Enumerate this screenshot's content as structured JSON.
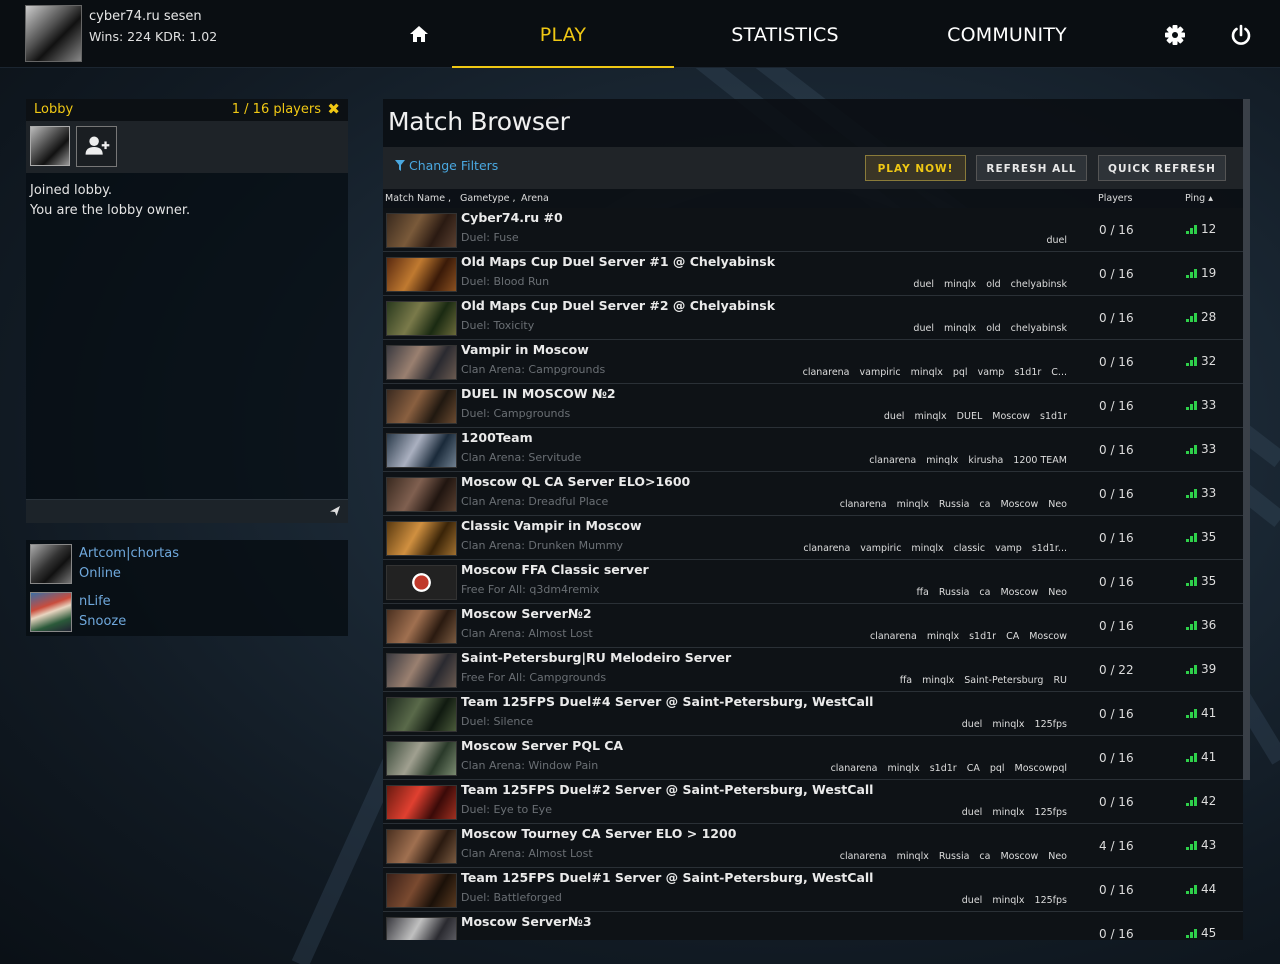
{
  "user": {
    "name": "cyber74.ru sesen",
    "stats": "Wins: 224 KDR: 1.02"
  },
  "nav": {
    "play": "PLAY",
    "statistics": "STATISTICS",
    "community": "COMMUNITY"
  },
  "lobby": {
    "title": "Lobby",
    "count": "1 / 16 players",
    "close": "✖",
    "messages": [
      "Joined lobby.",
      "You are the lobby owner."
    ]
  },
  "friends": [
    {
      "name": "Artcom|chortas",
      "status": "Online"
    },
    {
      "name": "nLife",
      "status": "Snooze"
    }
  ],
  "browser": {
    "title": "Match Browser",
    "filters": "Change Filters",
    "buttons": {
      "play_now": "PLAY NOW!",
      "refresh_all": "REFRESH ALL",
      "quick_refresh": "QUICK REFRESH"
    },
    "columns": {
      "name": "Match Name ,",
      "gametype": "Gametype ,",
      "arena": "Arena",
      "players": "Players",
      "ping": "Ping ▴"
    },
    "matches": [
      {
        "name": "Cyber74.ru #0",
        "sub": "Duel: Fuse",
        "tags": [
          "duel"
        ],
        "players": "0 / 16",
        "ping": "12"
      },
      {
        "name": "Old Maps Cup Duel Server #1 @ Chelyabinsk",
        "sub": "Duel: Blood Run",
        "tags": [
          "duel",
          "minqlx",
          "old",
          "chelyabinsk"
        ],
        "players": "0 / 16",
        "ping": "19"
      },
      {
        "name": "Old Maps Cup Duel Server #2 @ Chelyabinsk",
        "sub": "Duel: Toxicity",
        "tags": [
          "duel",
          "minqlx",
          "old",
          "chelyabinsk"
        ],
        "players": "0 / 16",
        "ping": "28"
      },
      {
        "name": "Vampir in Moscow",
        "sub": "Clan Arena: Campgrounds",
        "tags": [
          "clanarena",
          "vampiric",
          "minqlx",
          "pql",
          "vamp",
          "s1d1r",
          "C..."
        ],
        "players": "0 / 16",
        "ping": "32"
      },
      {
        "name": "DUEL IN MOSCOW №2",
        "sub": "Duel: Campgrounds",
        "tags": [
          "duel",
          "minqlx",
          "DUEL",
          "Moscow",
          "s1d1r"
        ],
        "players": "0 / 16",
        "ping": "33"
      },
      {
        "name": "1200Team",
        "sub": "Clan Arena: Servitude",
        "tags": [
          "clanarena",
          "minqlx",
          "kirusha",
          "1200 TEAM"
        ],
        "players": "0 / 16",
        "ping": "33"
      },
      {
        "name": "Moscow QL CA Server ELO>1600",
        "sub": "Clan Arena: Dreadful Place",
        "tags": [
          "clanarena",
          "minqlx",
          "Russia",
          "ca",
          "Moscow",
          "Neo"
        ],
        "players": "0 / 16",
        "ping": "33"
      },
      {
        "name": "Classic Vampir in Moscow",
        "sub": "Clan Arena: Drunken Mummy",
        "tags": [
          "clanarena",
          "vampiric",
          "minqlx",
          "classic",
          "vamp",
          "s1d1r..."
        ],
        "players": "0 / 16",
        "ping": "35"
      },
      {
        "name": "Moscow FFA Classic server",
        "sub": "Free For All: q3dm4remix",
        "tags": [
          "ffa",
          "Russia",
          "ca",
          "Moscow",
          "Neo"
        ],
        "players": "0 / 16",
        "ping": "35"
      },
      {
        "name": "Moscow Server№2",
        "sub": "Clan Arena: Almost Lost",
        "tags": [
          "clanarena",
          "minqlx",
          "s1d1r",
          "CA",
          "Moscow"
        ],
        "players": "0 / 16",
        "ping": "36"
      },
      {
        "name": "Saint-Petersburg|RU Melodeiro Server",
        "sub": "Free For All: Campgrounds",
        "tags": [
          "ffa",
          "minqlx",
          "Saint-Petersburg",
          "RU"
        ],
        "players": "0 / 22",
        "ping": "39"
      },
      {
        "name": "Team 125FPS Duel#4 Server @ Saint-Petersburg, WestCall",
        "sub": "Duel: Silence",
        "tags": [
          "duel",
          "minqlx",
          "125fps"
        ],
        "players": "0 / 16",
        "ping": "41"
      },
      {
        "name": "Moscow Server PQL CA",
        "sub": "Clan Arena: Window Pain",
        "tags": [
          "clanarena",
          "minqlx",
          "s1d1r",
          "CA",
          "pql",
          "Moscowpql"
        ],
        "players": "0 / 16",
        "ping": "41"
      },
      {
        "name": "Team 125FPS Duel#2 Server @ Saint-Petersburg, WestCall",
        "sub": "Duel: Eye to Eye",
        "tags": [
          "duel",
          "minqlx",
          "125fps"
        ],
        "players": "0 / 16",
        "ping": "42"
      },
      {
        "name": "Moscow Tourney CA Server ELO > 1200",
        "sub": "Clan Arena: Almost Lost",
        "tags": [
          "clanarena",
          "minqlx",
          "Russia",
          "ca",
          "Moscow",
          "Neo"
        ],
        "players": "4 / 16",
        "ping": "43"
      },
      {
        "name": "Team 125FPS Duel#1 Server @ Saint-Petersburg, WestCall",
        "sub": "Duel: Battleforged",
        "tags": [
          "duel",
          "minqlx",
          "125fps"
        ],
        "players": "0 / 16",
        "ping": "44"
      },
      {
        "name": "Moscow Server№3",
        "sub": "",
        "tags": [],
        "players": "0 / 16",
        "ping": "45"
      }
    ]
  },
  "colors": {
    "accent": "#f0c814",
    "link": "#4aa8e0",
    "ping_bars": "#2ed04a"
  }
}
